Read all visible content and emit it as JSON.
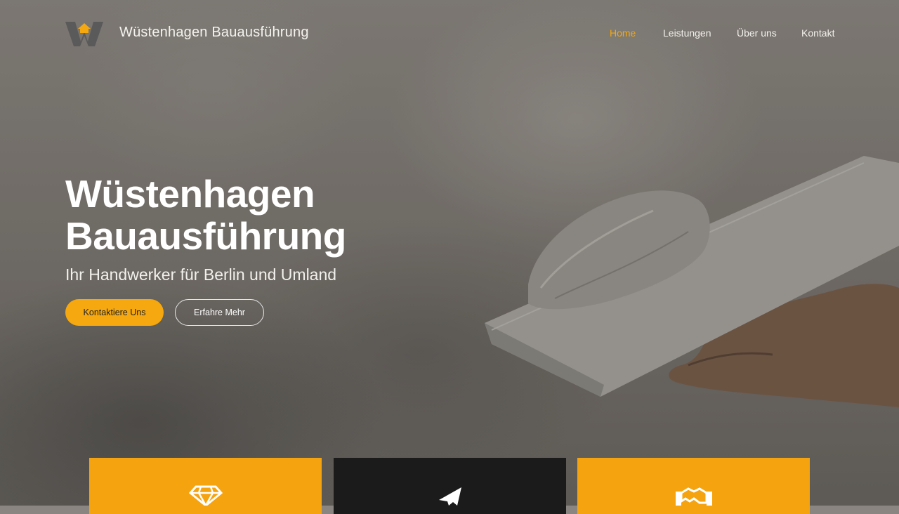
{
  "header": {
    "brand": "Wüstenhagen Bauausführung",
    "logo_icon": "w-roof-logo-icon",
    "nav": [
      {
        "label": "Home",
        "active": true
      },
      {
        "label": "Leistungen",
        "active": false
      },
      {
        "label": "Über uns",
        "active": false
      },
      {
        "label": "Kontakt",
        "active": false
      }
    ]
  },
  "hero": {
    "title_line1": "Wüstenhagen",
    "title_line2": "Bauausführung",
    "subtitle": "Ihr Handwerker für Berlin und Umland",
    "primary_button": "Kontaktiere Uns",
    "secondary_button": "Erfahre Mehr"
  },
  "cards": [
    {
      "icon": "diamond-icon",
      "color": "#f5a30f"
    },
    {
      "icon": "paper-plane-icon",
      "color": "#1b1b1b"
    },
    {
      "icon": "handshake-icon",
      "color": "#f5a30f"
    }
  ],
  "colors": {
    "accent": "#f5a80f",
    "dark": "#1b1b1b",
    "text": "#ffffff"
  }
}
